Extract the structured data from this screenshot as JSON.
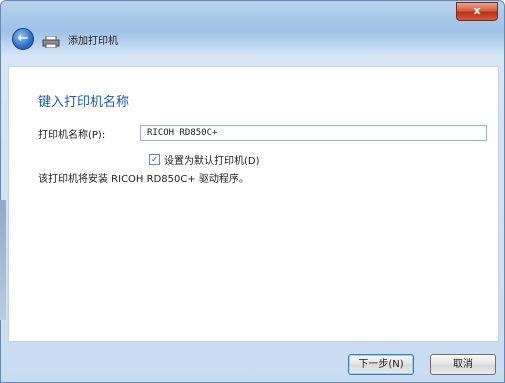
{
  "window": {
    "close_label": "x"
  },
  "nav": {
    "back_icon": "back-arrow-icon",
    "printer_icon": "printer-icon",
    "title": "添加打印机"
  },
  "main": {
    "heading": "键入打印机名称",
    "printer_name_label": "打印机名称(P):",
    "printer_name_value": "RICOH RD850C+",
    "set_default_label": "设置为默认打印机(D)",
    "set_default_checked": true,
    "driver_note": "该打印机将安装 RICOH RD850C+ 驱动程序。"
  },
  "footer": {
    "next_label": "下一步(N)",
    "cancel_label": "取消"
  },
  "colors": {
    "heading": "#1c5bab",
    "close_button": "#c8402a",
    "frame": "#9ec1e6"
  }
}
